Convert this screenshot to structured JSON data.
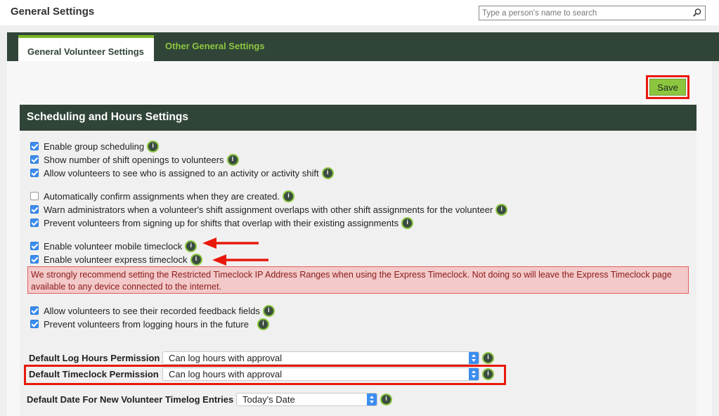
{
  "header": {
    "title": "General Settings",
    "search_placeholder": "Type a person's name to search"
  },
  "tabs": [
    {
      "label": "General Volunteer Settings",
      "active": true
    },
    {
      "label": "Other General Settings",
      "active": false
    }
  ],
  "actions": {
    "save_label": "Save"
  },
  "section": {
    "title": "Scheduling and Hours Settings",
    "options": [
      {
        "label": "Enable group scheduling",
        "checked": true
      },
      {
        "label": "Show number of shift openings to volunteers",
        "checked": true
      },
      {
        "label": "Allow volunteers to see who is assigned to an activity or activity shift",
        "checked": true
      },
      {
        "label": "Automatically confirm assignments when they are created.",
        "checked": false
      },
      {
        "label": "Warn administrators when a volunteer's shift assignment overlaps with other shift assignments for the volunteer",
        "checked": true
      },
      {
        "label": "Prevent volunteers from signing up for shifts that overlap with their existing assignments",
        "checked": true
      },
      {
        "label": "Enable volunteer mobile timeclock",
        "checked": true
      },
      {
        "label": "Enable volunteer express timeclock",
        "checked": true
      },
      {
        "label": "Allow volunteers to see their recorded feedback fields",
        "checked": true
      },
      {
        "label": "Prevent volunteers from logging hours in the future",
        "checked": true
      }
    ],
    "warning": "We strongly recommend setting the Restricted Timeclock IP Address Ranges when using the Express Timeclock. Not doing so will leave the Express Timeclock page available to any device connected to the internet.",
    "fields": [
      {
        "label": "Default Log Hours Permission",
        "value": "Can log hours with approval"
      },
      {
        "label": "Default Timeclock Permission",
        "value": "Can log hours with approval"
      },
      {
        "label": "Default Date For New Volunteer Timelog Entries",
        "value": "Today's Date"
      }
    ]
  },
  "colors": {
    "header_green": "#304538",
    "accent_green": "#8cc63f",
    "highlight_red": "#e8190c",
    "checkbox_blue": "#3b8df0",
    "warning_bg": "#f3c9c9"
  },
  "icons": [
    "search-icon",
    "info-icon",
    "red-arrow-icon",
    "select-arrows-icon"
  ]
}
